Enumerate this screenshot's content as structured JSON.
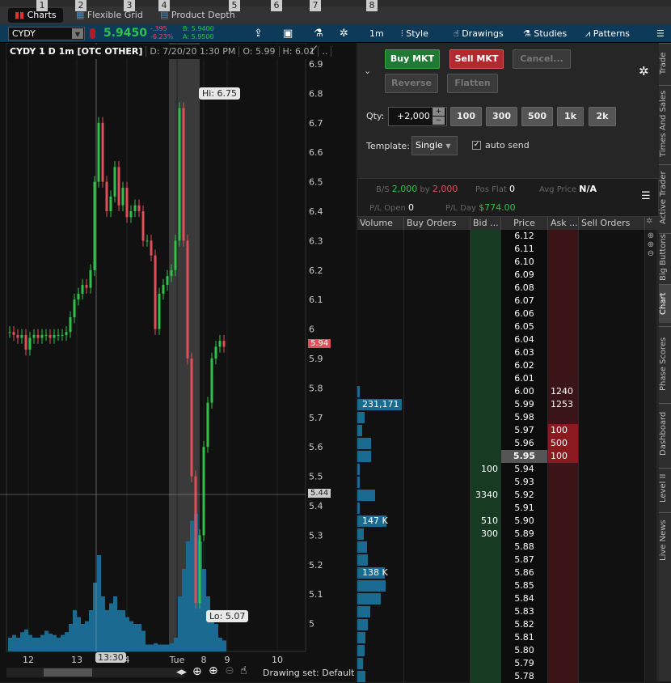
{
  "menu_numbers": [
    "1",
    "2",
    "3",
    "4",
    "5",
    "6",
    "7",
    "8"
  ],
  "tabs": [
    {
      "label": "Charts",
      "active": true
    },
    {
      "label": "Flexible Grid"
    },
    {
      "label": "Product Depth"
    }
  ],
  "toolbar": {
    "symbol": "CYDY",
    "last": "5.9450",
    "change": "-.395",
    "change_pct": "-6.23%",
    "bid": "B: 5.9400",
    "ask": "A: 5.9500",
    "interval": "1m",
    "style": "Style",
    "drawings": "Drawings",
    "studies": "Studies",
    "patterns": "Patterns"
  },
  "chart": {
    "title": "CYDY 1 D 1m [OTC OTHER]",
    "date": "D: 7/20/20 1:30 PM",
    "open": "O: 5.99",
    "high": "H: 6.01",
    "more": "..",
    "hi_label": "Hi: 6.75",
    "lo_label": "Lo: 5.07",
    "last_marker": "5.94",
    "cursor_price": "5.44",
    "cursor_time": "13:30",
    "drawing_set": "Drawing set: Default"
  },
  "chart_data": {
    "type": "candlestick",
    "ylim": [
      4.95,
      6.95
    ],
    "y_ticks": [
      "6.9",
      "6.8",
      "6.7",
      "6.6",
      "6.5",
      "6.4",
      "6.3",
      "6.2",
      "6.1",
      "6",
      "5.9",
      "5.8",
      "5.7",
      "5.6",
      "5.5",
      "5.4",
      "5.3",
      "5.2",
      "5.1",
      "5"
    ],
    "x_ticks": [
      "12",
      "13",
      "4",
      "Tue",
      "8",
      "9",
      "10"
    ],
    "closes": [
      5.99,
      5.98,
      5.97,
      5.98,
      5.93,
      5.97,
      5.98,
      5.97,
      5.98,
      5.98,
      5.97,
      5.98,
      5.98,
      5.98,
      5.99,
      6.04,
      6.1,
      6.12,
      6.15,
      6.14,
      6.2,
      6.5,
      6.7,
      6.5,
      6.4,
      6.45,
      6.55,
      6.42,
      6.48,
      6.38,
      6.4,
      6.42,
      6.4,
      6.3,
      6.3,
      6.25,
      6.0,
      6.12,
      6.15,
      6.18,
      6.2,
      6.3,
      6.75,
      6.3,
      5.9,
      5.5,
      5.07,
      5.3,
      5.6,
      5.75,
      5.9,
      5.94,
      5.96,
      5.94
    ],
    "volume": [
      0.1,
      0.12,
      0.1,
      0.14,
      0.16,
      0.12,
      0.1,
      0.1,
      0.12,
      0.15,
      0.13,
      0.12,
      0.1,
      0.12,
      0.14,
      0.2,
      0.3,
      0.25,
      0.2,
      0.22,
      0.3,
      0.5,
      0.7,
      0.4,
      0.3,
      0.35,
      0.4,
      0.3,
      0.3,
      0.25,
      0.22,
      0.2,
      0.2,
      0.15,
      0.05,
      0.05,
      0.06,
      0.05,
      0.05,
      0.05,
      0.06,
      0.1,
      0.4,
      0.6,
      0.8,
      0.95,
      1.0,
      0.8,
      0.6,
      0.4,
      0.3,
      0.2,
      0.1,
      0.08
    ]
  },
  "order": {
    "buy": "Buy MKT",
    "sell": "Sell MKT",
    "cancel": "Cancel...",
    "reverse": "Reverse",
    "flatten": "Flatten",
    "qty_label": "Qty:",
    "qty": "+2,000",
    "qty_presets": [
      "100",
      "300",
      "500",
      "1k",
      "2k"
    ],
    "template_label": "Template:",
    "template": "Single",
    "auto_send": "auto send"
  },
  "info": {
    "bs_label": "B/S",
    "bs_buy": "2,000",
    "by": "by",
    "bs_sell": "2,000",
    "pos_label": "Pos Flat",
    "pos": "0",
    "avg_label": "Avg Price",
    "avg": "N/A",
    "plopen_label": "P/L Open",
    "plopen": "0",
    "plday_label": "P/L Day",
    "plday": "$774.00"
  },
  "ladder": {
    "headers": [
      "Volume",
      "Buy Orders",
      "Bid ...",
      "Price",
      "Ask ...",
      "Sell Orders"
    ],
    "rows": [
      {
        "price": "6.12"
      },
      {
        "price": "6.11"
      },
      {
        "price": "6.10"
      },
      {
        "price": "6.09"
      },
      {
        "price": "6.08"
      },
      {
        "price": "6.07"
      },
      {
        "price": "6.06"
      },
      {
        "price": "6.05"
      },
      {
        "price": "6.04"
      },
      {
        "price": "6.03"
      },
      {
        "price": "6.02"
      },
      {
        "price": "6.01"
      },
      {
        "price": "6.00",
        "ask": "1240",
        "vol": 0.05
      },
      {
        "price": "5.99",
        "ask": "1253",
        "vol": 0.95,
        "vol_label": "231,171"
      },
      {
        "price": "5.98",
        "vol": 0.15
      },
      {
        "price": "5.97",
        "ask": "100",
        "vol": 0.1
      },
      {
        "price": "5.96",
        "ask": "500",
        "vol": 0.3
      },
      {
        "price": "5.95",
        "ask": "100",
        "vol": 0.3,
        "current": true
      },
      {
        "price": "5.94",
        "bid": "100",
        "vol": 0.05
      },
      {
        "price": "5.93",
        "vol": 0.05
      },
      {
        "price": "5.92",
        "bid": "3340",
        "vol": 0.38
      },
      {
        "price": "5.91",
        "vol": 0.05
      },
      {
        "price": "5.90",
        "bid": "510",
        "vol": 0.62,
        "vol_label": "147 K"
      },
      {
        "price": "5.89",
        "bid": "300",
        "vol": 0.14
      },
      {
        "price": "5.88",
        "vol": 0.2
      },
      {
        "price": "5.87",
        "vol": 0.22
      },
      {
        "price": "5.86",
        "vol": 0.58,
        "vol_label": "138 K"
      },
      {
        "price": "5.85",
        "vol": 0.6
      },
      {
        "price": "5.84",
        "vol": 0.5
      },
      {
        "price": "5.83",
        "vol": 0.28
      },
      {
        "price": "5.82",
        "vol": 0.22
      },
      {
        "price": "5.81",
        "vol": 0.18
      },
      {
        "price": "5.80",
        "vol": 0.15
      },
      {
        "price": "5.79",
        "vol": 0.12
      },
      {
        "price": "5.78",
        "vol": 0.18
      }
    ]
  },
  "side_tabs": [
    "Trade",
    "Times And Sales",
    "Active Trader",
    "Big Buttons",
    "Chart",
    "Phase Scores",
    "Dashboard",
    "Level II",
    "Live News"
  ],
  "colors": {
    "up": "#2ec24a",
    "down": "#e0505a",
    "accent": "#0d3a59",
    "volume": "#1a6a92"
  }
}
